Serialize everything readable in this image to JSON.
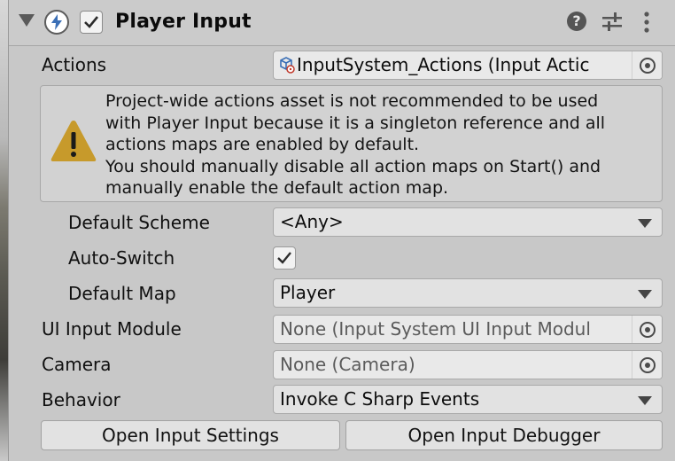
{
  "header": {
    "title": "Player Input",
    "icons": [
      "foldout-arrow-icon",
      "lightning-icon",
      "checkbox-checked-icon",
      "help-icon",
      "settings-sliders-icon",
      "kebab-menu-icon"
    ]
  },
  "fields": {
    "actions": {
      "label": "Actions",
      "value": "InputSystem_Actions (Input Actic"
    },
    "help": {
      "lines": [
        "Project-wide actions asset is not recommended to be used",
        "with Player Input because it is a singleton reference and all",
        "actions maps are enabled by default.",
        "You should manually disable all action maps on Start() and",
        "manually enable the default action map."
      ]
    },
    "default_scheme": {
      "label": "Default Scheme",
      "value": "<Any>"
    },
    "auto_switch": {
      "label": "Auto-Switch",
      "checked": true
    },
    "default_map": {
      "label": "Default Map",
      "value": "Player"
    },
    "ui_input_module": {
      "label": "UI Input Module",
      "value": "None (Input System UI Input Modul"
    },
    "camera": {
      "label": "Camera",
      "value": "None (Camera)"
    },
    "behavior": {
      "label": "Behavior",
      "value": "Invoke C Sharp Events"
    }
  },
  "buttons": {
    "open_settings": "Open Input Settings",
    "open_debugger": "Open Input Debugger"
  },
  "colors": {
    "panel_bg": "#c8c8c8",
    "field_bg": "#e6e6e6",
    "warning": "#c79a2b"
  }
}
